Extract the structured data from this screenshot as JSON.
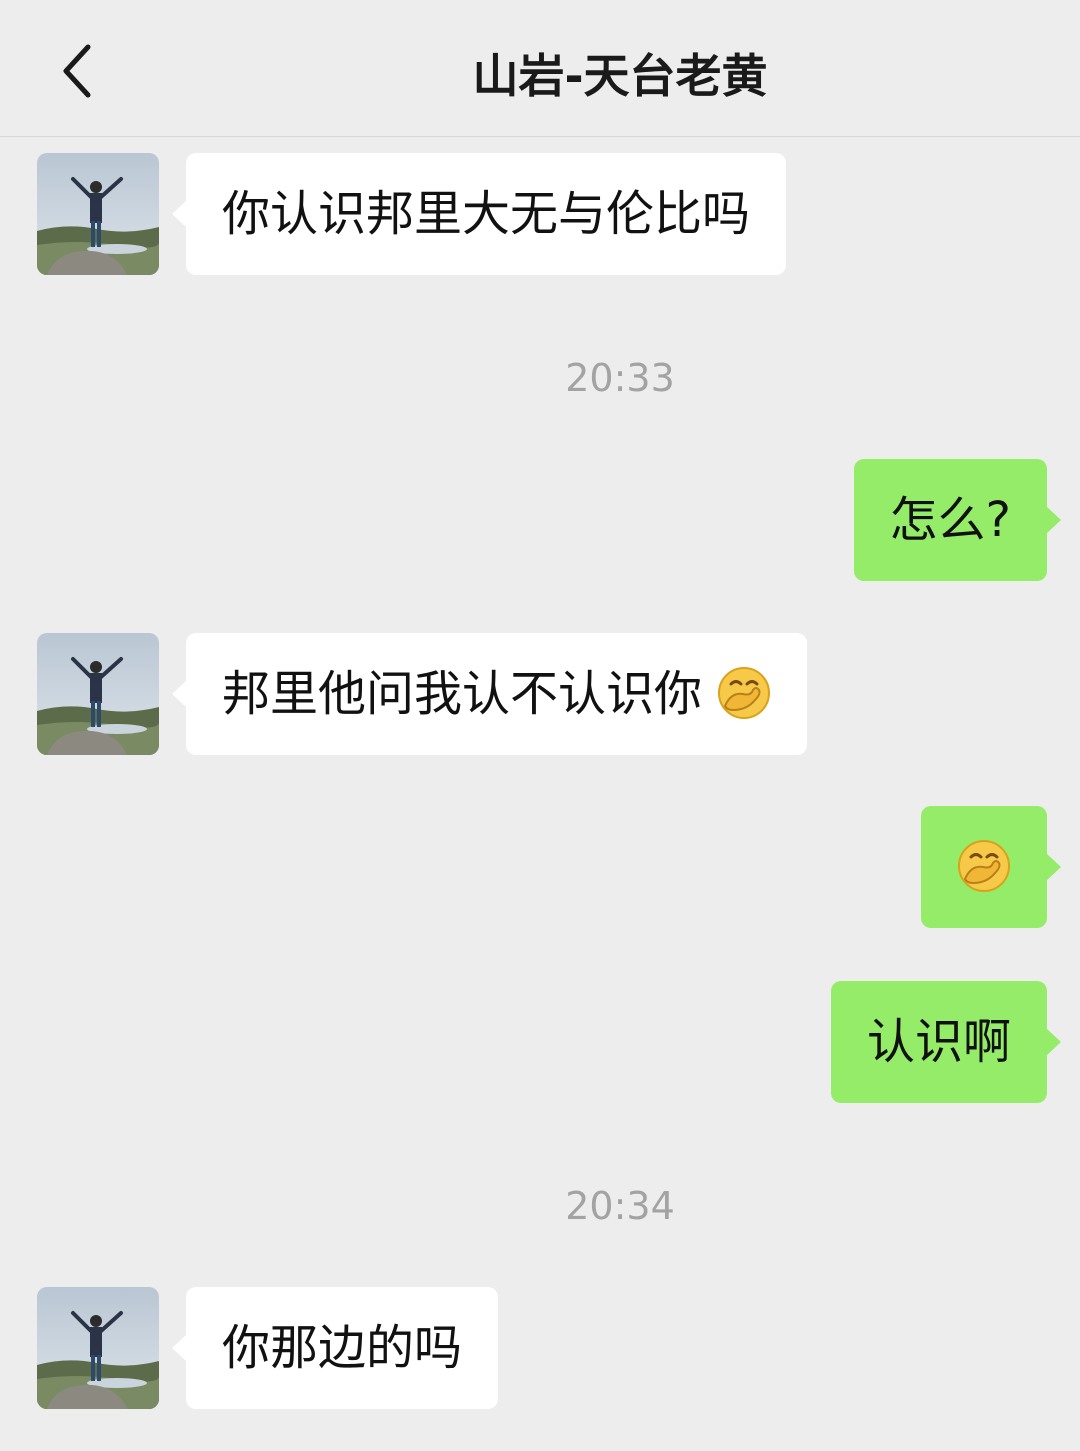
{
  "header": {
    "title": "山岩-天台老黄"
  },
  "messages": [
    {
      "text": "你认识邦里大无与伦比吗"
    },
    {
      "time": "20:33"
    },
    {
      "text": "怎么?"
    },
    {
      "text": "邦里他问我认不认识你"
    },
    {
      "emoji": "hand-over-mouth-emoji"
    },
    {
      "text": "认识啊"
    },
    {
      "time": "20:34"
    },
    {
      "text": "你那边的吗"
    }
  ],
  "colors": {
    "background": "#ededed",
    "incoming_bubble": "#ffffff",
    "outgoing_bubble": "#95ec69",
    "timestamp": "#a3a3a3"
  }
}
